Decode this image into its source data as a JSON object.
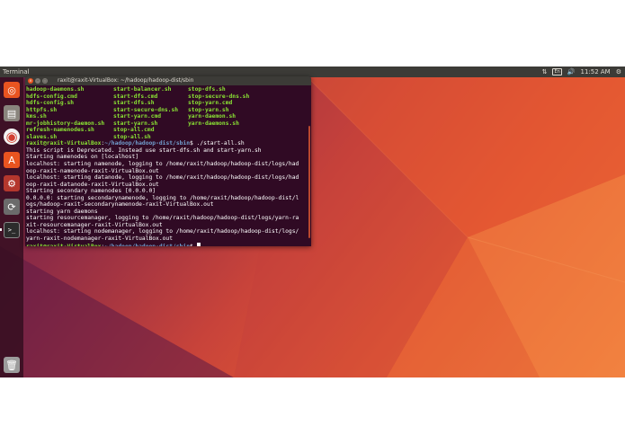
{
  "topbar": {
    "app_name": "Terminal",
    "indicators": {
      "network": "⇅",
      "keyboard": "En",
      "sound": "🔊",
      "clock": "11:52 AM",
      "system": "⚙"
    }
  },
  "launcher": {
    "items": [
      {
        "name": "ubuntu-dash-icon",
        "color": "#e95420",
        "glyph": "◎"
      },
      {
        "name": "files-icon",
        "color": "#8a857d",
        "glyph": "▤"
      },
      {
        "name": "chrome-icon",
        "color": "#f3f3f3",
        "glyph": "◉"
      },
      {
        "name": "software-center-icon",
        "color": "#e95420",
        "glyph": "A"
      },
      {
        "name": "settings-icon",
        "color": "#b4372d",
        "glyph": "⚙"
      },
      {
        "name": "software-updater-icon",
        "color": "#6b6b6b",
        "glyph": "⟳"
      },
      {
        "name": "terminal-icon",
        "color": "#2c2c2c",
        "glyph": ">_"
      },
      {
        "name": "trash-icon",
        "color": "#9c9c9c",
        "glyph": "🗑"
      }
    ]
  },
  "terminal": {
    "title": "raxit@raxit-VirtualBox: ~/hadoop/hadoop-dist/sbin",
    "ls_rows": [
      [
        "hadoop-daemons.sh",
        "start-balancer.sh",
        "stop-dfs.sh"
      ],
      [
        "hdfs-config.cmd",
        "start-dfs.cmd",
        "stop-secure-dns.sh"
      ],
      [
        "hdfs-config.sh",
        "start-dfs.sh",
        "stop-yarn.cmd"
      ],
      [
        "httpfs.sh",
        "start-secure-dns.sh",
        "stop-yarn.sh"
      ],
      [
        "kms.sh",
        "start-yarn.cmd",
        "yarn-daemon.sh"
      ],
      [
        "mr-jobhistory-daemon.sh",
        "start-yarn.sh",
        "yarn-daemons.sh"
      ],
      [
        "refresh-namenodes.sh",
        "stop-all.cmd",
        ""
      ],
      [
        "slaves.sh",
        "stop-all.sh",
        ""
      ]
    ],
    "prompt_user": "raxit@raxit-VirtualBox",
    "prompt_path": "~/hadoop/hadoop-dist/sbin",
    "command": " ./start-all.sh",
    "output_lines": [
      "This script is Deprecated. Instead use start-dfs.sh and start-yarn.sh",
      "Starting namenodes on [localhost]",
      "localhost: starting namenode, logging to /home/raxit/hadoop/hadoop-dist/logs/had",
      "oop-raxit-namenode-raxit-VirtualBox.out",
      "localhost: starting datanode, logging to /home/raxit/hadoop/hadoop-dist/logs/had",
      "oop-raxit-datanode-raxit-VirtualBox.out",
      "Starting secondary namenodes [0.0.0.0]",
      "0.0.0.0: starting secondarynamenode, logging to /home/raxit/hadoop/hadoop-dist/l",
      "ogs/hadoop-raxit-secondarynamenode-raxit-VirtualBox.out",
      "starting yarn daemons",
      "starting resourcemanager, logging to /home/raxit/hadoop/hadoop-dist/logs/yarn-ra",
      "xit-resourcemanager-raxit-VirtualBox.out",
      "localhost: starting nodemanager, logging to /home/raxit/hadoop/hadoop-dist/logs/",
      "yarn-raxit-nodemanager-raxit-VirtualBox.out"
    ]
  }
}
